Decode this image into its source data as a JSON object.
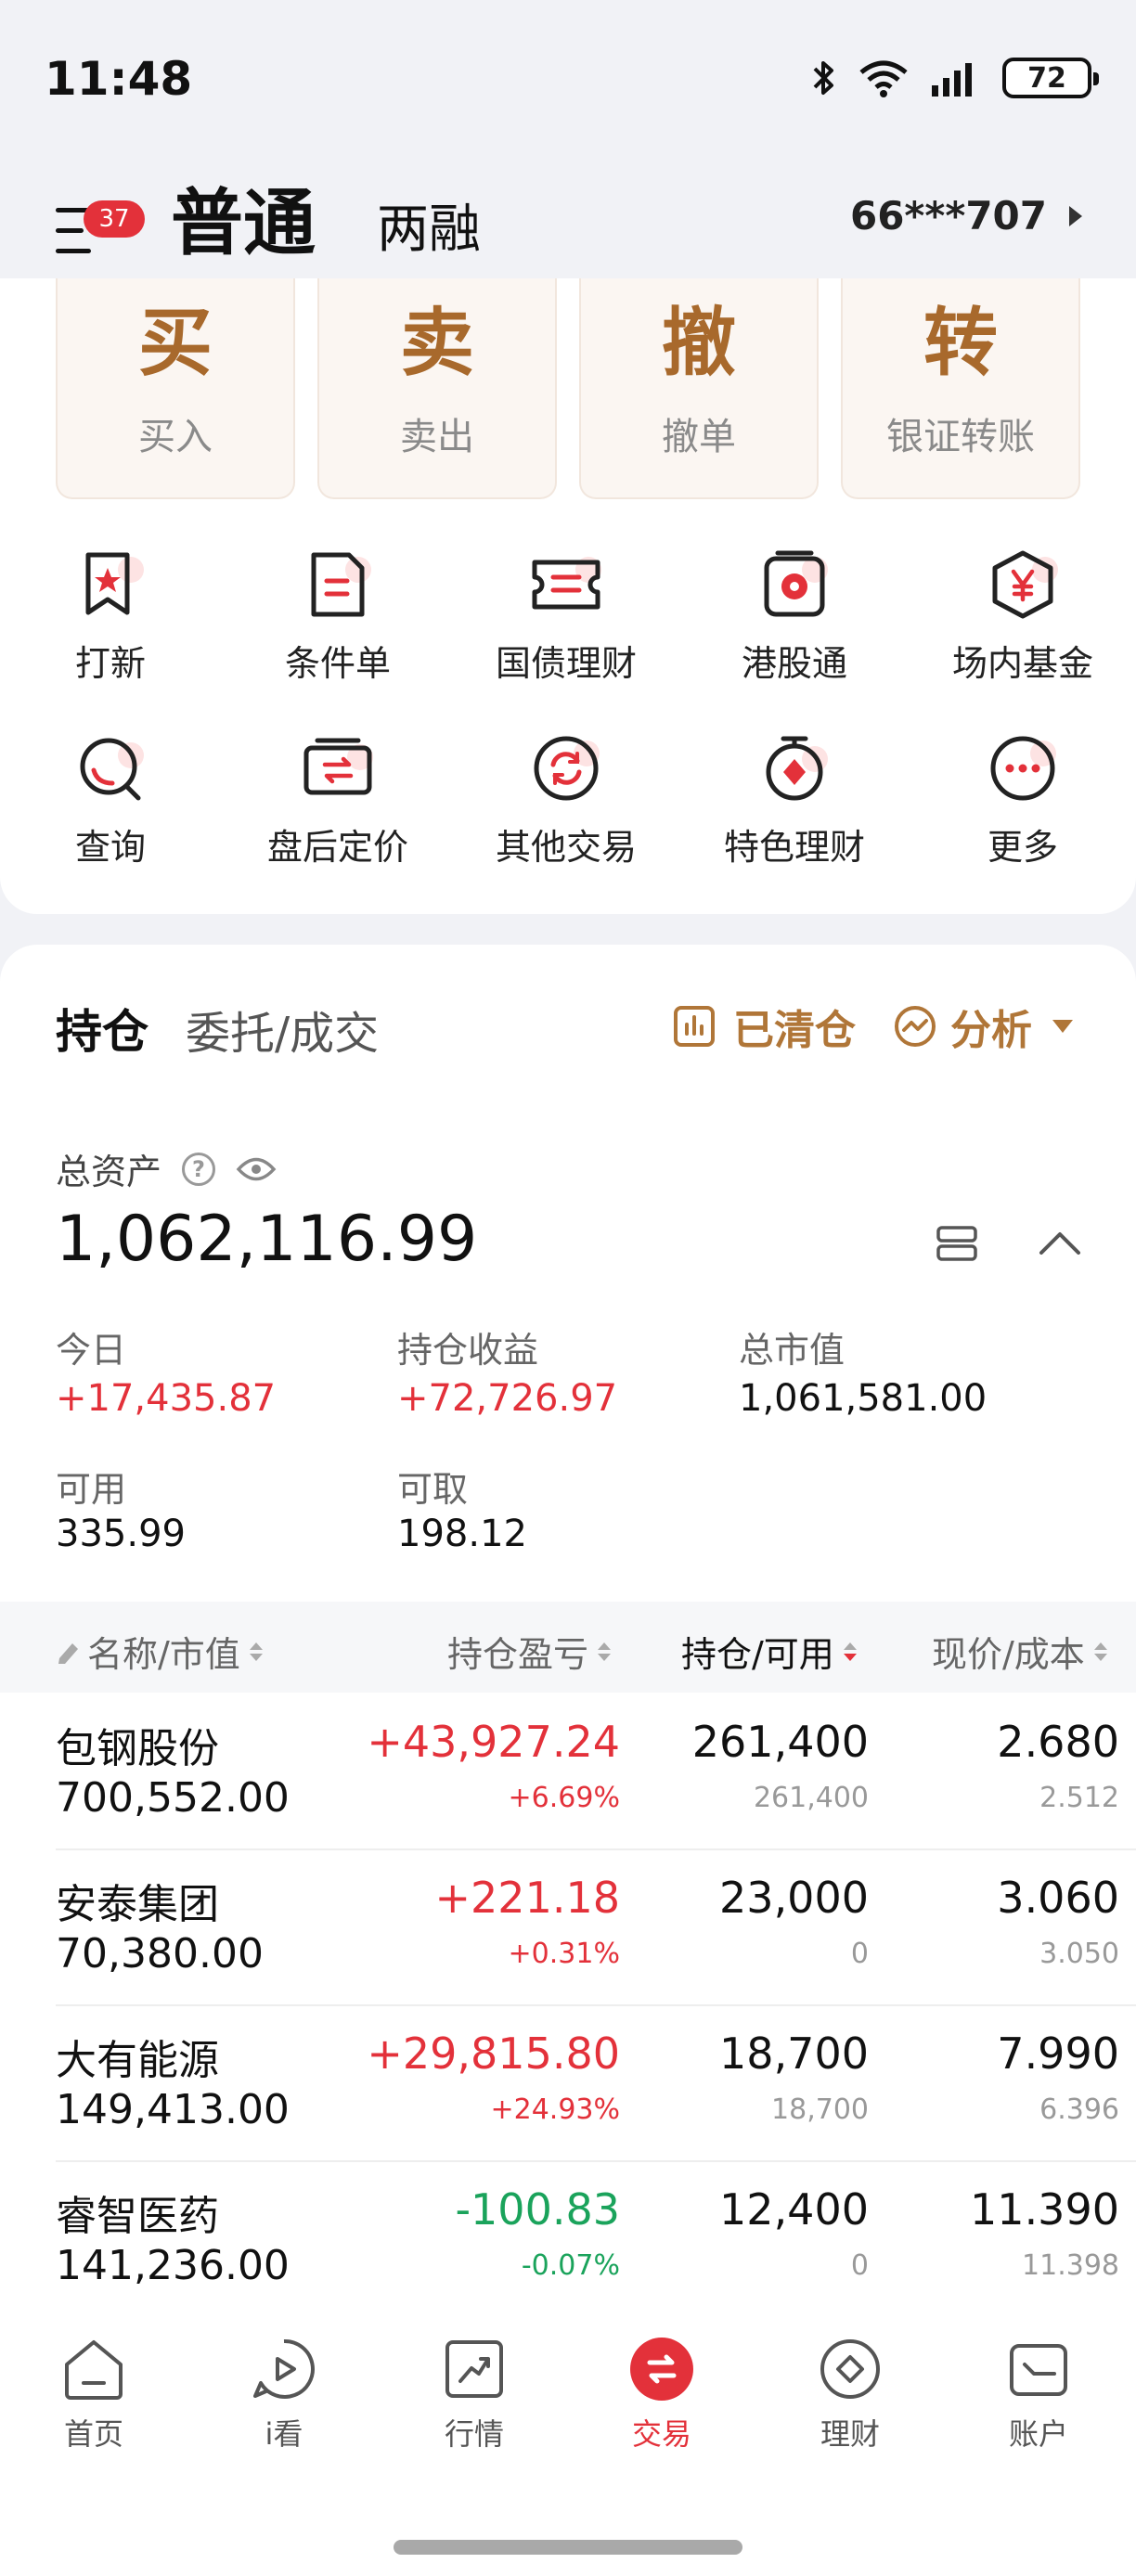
{
  "status_bar": {
    "time": "11:48",
    "battery": "72"
  },
  "header": {
    "badge_count": "37",
    "tab_normal": "普通",
    "tab_margin": "两融",
    "account": "66***707"
  },
  "actions": [
    {
      "char": "买",
      "label": "买入"
    },
    {
      "char": "卖",
      "label": "卖出"
    },
    {
      "char": "撤",
      "label": "撤单"
    },
    {
      "char": "转",
      "label": "银证转账"
    }
  ],
  "grid": [
    {
      "label": "打新",
      "icon": "bookmark-star-icon"
    },
    {
      "label": "条件单",
      "icon": "document-icon"
    },
    {
      "label": "国债理财",
      "icon": "ticket-icon"
    },
    {
      "label": "港股通",
      "icon": "hk-flower-icon"
    },
    {
      "label": "场内基金",
      "icon": "yen-hexagon-icon"
    },
    {
      "label": "查询",
      "icon": "search-icon"
    },
    {
      "label": "盘后定价",
      "icon": "transfer-card-icon"
    },
    {
      "label": "其他交易",
      "icon": "refresh-circle-icon"
    },
    {
      "label": "特色理财",
      "icon": "gem-icon"
    },
    {
      "label": "更多",
      "icon": "more-dots-icon"
    }
  ],
  "holdings": {
    "tab_positions": "持仓",
    "tab_orders": "委托/成交",
    "cleared_label": "已清仓",
    "analysis_label": "分析",
    "total_assets_label": "总资产",
    "total_assets": "1,062,116.99",
    "stats": {
      "today_label": "今日",
      "today": "+17,435.87",
      "position_profit_label": "持仓收益",
      "position_profit": "+72,726.97",
      "market_value_label": "总市值",
      "market_value": "1,061,581.00",
      "available_label": "可用",
      "available": "335.99",
      "withdrawable_label": "可取",
      "withdrawable": "198.12"
    },
    "columns": {
      "name": "名称/市值",
      "pl": "持仓盈亏",
      "qty": "持仓/可用",
      "price": "现价/成本"
    },
    "rows": [
      {
        "name": "包钢股份",
        "market_value": "700,552.00",
        "pl": "+43,927.24",
        "pl_pct": "+6.69%",
        "qty": "261,400",
        "available": "261,400",
        "price": "2.680",
        "cost": "2.512",
        "trend": "up"
      },
      {
        "name": "安泰集团",
        "market_value": "70,380.00",
        "pl": "+221.18",
        "pl_pct": "+0.31%",
        "qty": "23,000",
        "available": "0",
        "price": "3.060",
        "cost": "3.050",
        "trend": "up"
      },
      {
        "name": "大有能源",
        "market_value": "149,413.00",
        "pl": "+29,815.80",
        "pl_pct": "+24.93%",
        "qty": "18,700",
        "available": "18,700",
        "price": "7.990",
        "cost": "6.396",
        "trend": "up"
      },
      {
        "name": "睿智医药",
        "market_value": "141,236.00",
        "pl": "-100.83",
        "pl_pct": "-0.07%",
        "qty": "12,400",
        "available": "0",
        "price": "11.390",
        "cost": "11.398",
        "trend": "down"
      }
    ]
  },
  "nav": [
    {
      "label": "首页",
      "icon": "home-icon"
    },
    {
      "label": "i看",
      "icon": "play-icon"
    },
    {
      "label": "行情",
      "icon": "chart-icon"
    },
    {
      "label": "交易",
      "icon": "exchange-icon",
      "active": true
    },
    {
      "label": "理财",
      "icon": "diamond-icon"
    },
    {
      "label": "账户",
      "icon": "account-icon"
    }
  ],
  "colors": {
    "accent_red": "#e3313a",
    "gain_green": "#1aa35b",
    "gold": "#a8692c"
  }
}
